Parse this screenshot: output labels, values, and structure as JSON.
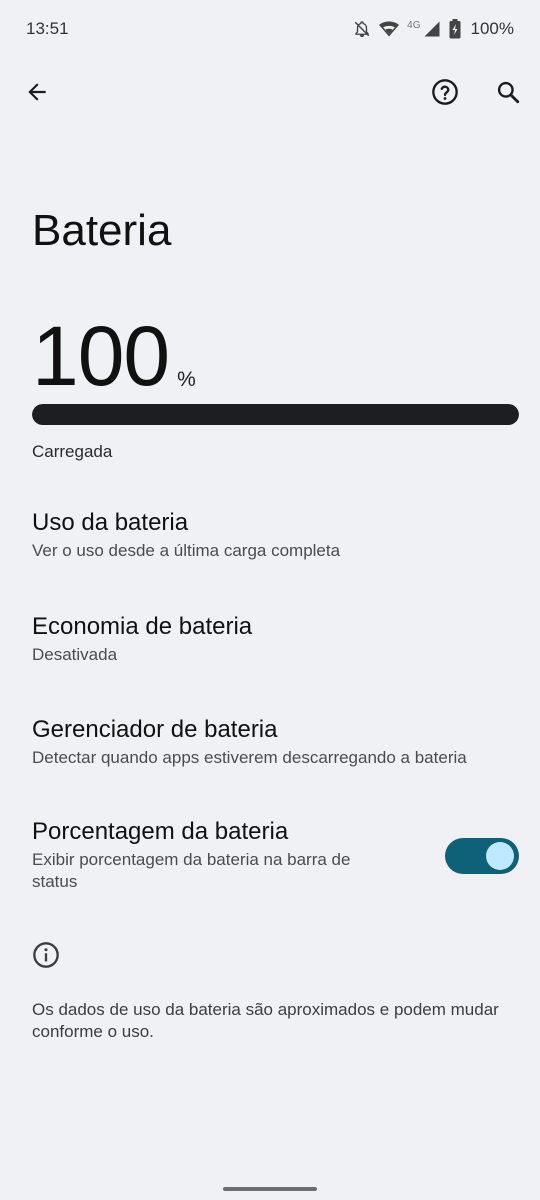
{
  "status_bar": {
    "time": "13:51",
    "network_label": "4G",
    "battery_percent": "100%",
    "icons": [
      "bell-off-icon",
      "wifi-icon",
      "signal-icon",
      "battery-charging-icon"
    ]
  },
  "toolbar": {
    "back_icon": "arrow-back-icon",
    "help_icon": "help-circle-icon",
    "search_icon": "search-icon"
  },
  "page": {
    "title": "Bateria",
    "level_number": "100",
    "level_unit": "%",
    "level_fraction": 1.0,
    "charge_status": "Carregada"
  },
  "items": [
    {
      "title": "Uso da bateria",
      "summary": "Ver o uso desde a última carga completa"
    },
    {
      "title": "Economia de bateria",
      "summary": "Desativada"
    },
    {
      "title": "Gerenciador de bateria",
      "summary": "Detectar quando apps estiverem descarregando a bateria"
    },
    {
      "title": "Porcentagem da bateria",
      "summary": "Exibir porcentagem da bateria na barra de status",
      "toggle_on": true
    }
  ],
  "footer": {
    "info_icon": "info-icon",
    "text": "Os dados de uso da bateria são aproximados e podem mudar conforme o uso."
  },
  "colors": {
    "background": "#f0f1f4",
    "progress_fill": "#1c1e21",
    "toggle_track": "#0f6178",
    "toggle_thumb": "#bfe9ff"
  }
}
